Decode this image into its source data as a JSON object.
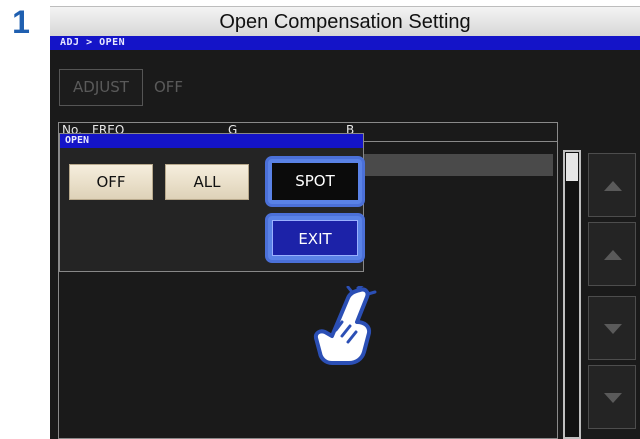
{
  "step": {
    "number": "1",
    "title": "Open Compensation Setting"
  },
  "screen": {
    "breadcrumb": "ADJ > OPEN",
    "adjust_button": "ADJUST",
    "adjust_state": "OFF",
    "table_headers": [
      "No.",
      "FREQ",
      "G",
      "B"
    ],
    "popup": {
      "title": "OPEN",
      "options": [
        "OFF",
        "ALL",
        "SPOT"
      ],
      "selected": "SPOT",
      "exit_label": "EXIT"
    },
    "scroll_buttons": [
      "page-up",
      "line-up",
      "line-down",
      "page-down"
    ]
  },
  "colors": {
    "step_number": "#1f5fb0",
    "title_bar": "#1414c8",
    "option_button": "#ede3cc",
    "highlight_ring": "#5a82e6",
    "exit_button": "#1c22a8",
    "screen_bg": "#1a1a1a"
  },
  "icons": [
    "tap-finger-icon",
    "triangle-up-icon",
    "triangle-down-icon"
  ]
}
